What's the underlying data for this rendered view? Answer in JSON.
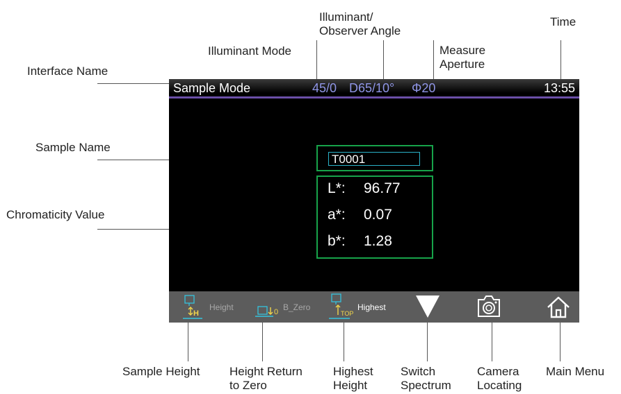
{
  "callouts": {
    "interface_name": "Interface Name",
    "illuminant_mode": "Illuminant Mode",
    "illuminant_observer_1": "Illuminant/",
    "illuminant_observer_2": "Observer Angle",
    "measure_aperture_1": "Measure",
    "measure_aperture_2": "Aperture",
    "time": "Time",
    "sample_name": "Sample Name",
    "chromaticity_value": "Chromaticity Value",
    "sample_height": "Sample Height",
    "height_return_1": "Height Return",
    "height_return_2": "to Zero",
    "highest_height_1": "Highest",
    "highest_height_2": "Height",
    "switch_spectrum_1": "Switch",
    "switch_spectrum_2": "Spectrum",
    "camera_locating_1": "Camera",
    "camera_locating_2": "Locating",
    "main_menu": "Main Menu"
  },
  "status": {
    "mode": "Sample Mode",
    "geometry": "45/0",
    "illuminant_observer": "D65/10°",
    "aperture": "Φ20",
    "time": "13:55"
  },
  "sample": {
    "name": "T0001"
  },
  "values": {
    "l_label": "L*:",
    "l_value": "96.77",
    "a_label": "a*:",
    "a_value": "0.07",
    "b_label": "b*:",
    "b_value": "1.28"
  },
  "toolbar": {
    "height_label": "Height",
    "bzero_label": "B_Zero",
    "highest_label": "Highest",
    "bzero_icon_text": "0",
    "highest_icon_text": "TOP",
    "height_icon_text": "H"
  },
  "icons": {
    "height": "sample-height-icon",
    "bzero": "height-zero-icon",
    "highest": "highest-height-icon",
    "switch": "triangle-down-icon",
    "camera": "camera-icon",
    "home": "home-icon"
  },
  "colors": {
    "status_accent": "#8f95e6",
    "box_border": "#17a34a",
    "name_field_border": "#2bb3c9",
    "toolbar_bg": "#5c5c5c",
    "icon_cyan": "#35c3de",
    "icon_yellow": "#f2d64b"
  }
}
